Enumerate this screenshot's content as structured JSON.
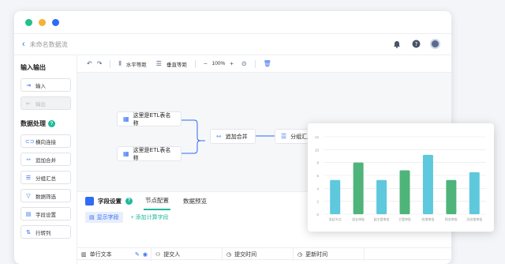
{
  "window": {
    "dots": [
      "#22c08a",
      "#f5b233",
      "#2f6bf5"
    ],
    "title": "未命名数据流",
    "icons": [
      "bell-icon",
      "help-icon",
      "avatar"
    ]
  },
  "sidebar": {
    "io_title": "输入输出",
    "io_items": [
      {
        "label": "输入",
        "icon": "input-icon",
        "disabled": false
      },
      {
        "label": "输出",
        "icon": "output-icon",
        "disabled": true
      }
    ],
    "proc_title": "数据处理",
    "proc_items": [
      {
        "label": "横向连接",
        "icon": "link-icon"
      },
      {
        "label": "追加合并",
        "icon": "merge-icon"
      },
      {
        "label": "分组汇总",
        "icon": "group-icon"
      },
      {
        "label": "数据筛选",
        "icon": "filter-icon"
      },
      {
        "label": "字段设置",
        "icon": "field-icon"
      },
      {
        "label": "行转列",
        "icon": "pivot-icon"
      }
    ]
  },
  "toolbar": {
    "h_equal": "水平等距",
    "v_equal": "垂直等距",
    "zoom": "100%"
  },
  "canvas": {
    "source1": "这里是ETL表名称",
    "source2": "这里是ETL表名称",
    "merge": "追加合并",
    "group": "分组汇总"
  },
  "bottom": {
    "title": "字段设置",
    "tab1": "节点配置",
    "tab2": "数据预览",
    "show_fields": "显示字段",
    "add_calc": "+ 添加计算字段",
    "columns": [
      "单行文本",
      "提交人",
      "提交时间",
      "更新时间"
    ]
  },
  "chart_data": {
    "type": "bar",
    "categories": [
      "发起节点",
      "组长审批",
      "副主管审批",
      "主管审批",
      "经理审批",
      "财务审批",
      "总经理审批"
    ],
    "values": [
      5.3,
      8,
      5.3,
      6.8,
      9.2,
      5.3,
      6.5
    ],
    "ylim": [
      0,
      12
    ],
    "yticks": [
      0,
      2,
      4,
      6,
      8,
      10,
      12
    ],
    "colors": {
      "blue": "#5ec8dc",
      "green": "#4fb47a"
    },
    "bar_color_keys": [
      "blue",
      "green",
      "blue",
      "green",
      "blue",
      "green",
      "blue"
    ],
    "grid": true
  }
}
